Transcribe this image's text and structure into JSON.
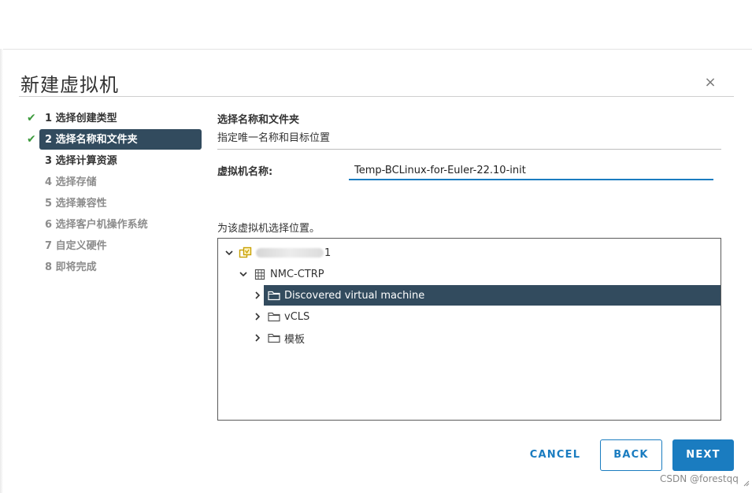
{
  "dialog": {
    "title": "新建虚拟机",
    "close_glyph": "×"
  },
  "steps": [
    {
      "label": "1 选择创建类型",
      "state": "done"
    },
    {
      "label": "2 选择名称和文件夹",
      "state": "active-done"
    },
    {
      "label": "3 选择计算资源",
      "state": "current"
    },
    {
      "label": "4 选择存储",
      "state": "pending"
    },
    {
      "label": "5 选择兼容性",
      "state": "pending"
    },
    {
      "label": "6 选择客户机操作系统",
      "state": "pending"
    },
    {
      "label": "7 自定义硬件",
      "state": "pending"
    },
    {
      "label": "8 即将完成",
      "state": "pending"
    }
  ],
  "content": {
    "section_title": "选择名称和文件夹",
    "section_subtitle": "指定唯一名称和目标位置",
    "vm_name_label": "虚拟机名称:",
    "vm_name_value": "Temp-BCLinux-for-Euler-22.10-init",
    "location_label": "为该虚拟机选择位置。"
  },
  "tree": {
    "root": {
      "label_suffix": "1",
      "icon": "vcenter-icon",
      "expanded": true
    },
    "datacenter": {
      "label": "NMC-CTRP",
      "icon": "datacenter-icon",
      "expanded": true
    },
    "folders": [
      {
        "label": "Discovered virtual machine",
        "icon": "folder-icon",
        "selected": true
      },
      {
        "label": "vCLS",
        "icon": "folder-icon",
        "selected": false
      },
      {
        "label": "模板",
        "icon": "folder-icon",
        "selected": false
      }
    ]
  },
  "buttons": {
    "cancel": "CANCEL",
    "back": "BACK",
    "next": "NEXT"
  },
  "watermark": "CSDN @forestqq",
  "colors": {
    "accent": "#1a7cc0",
    "selected_bg": "#324b5e",
    "check_green": "#3d9b3d",
    "pending_text": "#8c8c8c"
  }
}
